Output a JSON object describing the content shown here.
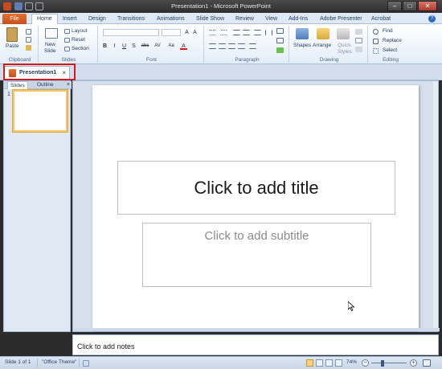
{
  "window": {
    "title": "Presentation1 - Microsoft PowerPoint",
    "minimize": "–",
    "maximize": "□",
    "close": "✕"
  },
  "ribbon_tabs": {
    "file": "File",
    "tabs": [
      "Home",
      "Insert",
      "Design",
      "Transitions",
      "Animations",
      "Slide Show",
      "Review",
      "View",
      "Add-Ins",
      "Adobe Presenter",
      "Acrobat"
    ],
    "active": "Home",
    "help": "?"
  },
  "ribbon": {
    "clipboard": {
      "label": "Clipboard",
      "paste": "Paste"
    },
    "slides": {
      "label": "Slides",
      "new_slide": "New",
      "new_slide2": "Slide",
      "layout": "Layout",
      "reset": "Reset",
      "section": "Section"
    },
    "font": {
      "label": "Font",
      "bold": "B",
      "italic": "I",
      "underline": "U",
      "shadow": "S",
      "strike": "abc",
      "spacing": "AV",
      "case": "Aa",
      "color": "A"
    },
    "paragraph": {
      "label": "Paragraph"
    },
    "drawing": {
      "label": "Drawing",
      "shapes": "Shapes",
      "arrange": "Arrange",
      "quick_styles": "Quick",
      "quick_styles2": "Styles"
    },
    "editing": {
      "label": "Editing",
      "find": "Find",
      "replace": "Replace",
      "select": "Select"
    }
  },
  "document_tab": {
    "label": "Presentation1",
    "close": "×"
  },
  "slides_pane": {
    "tabs": [
      "Slides",
      "Outline"
    ],
    "active_tab": "Slides",
    "close": "×",
    "thumbnail_number": "1"
  },
  "slide": {
    "title_placeholder": "Click to add title",
    "subtitle_placeholder": "Click to add subtitle"
  },
  "notes": {
    "placeholder": "Click to add notes"
  },
  "status_bar": {
    "slide_count": "Slide 1 of 1",
    "theme": "\"Office Theme\"",
    "zoom": "74%",
    "zoom_minus": "−",
    "zoom_plus": "+"
  }
}
